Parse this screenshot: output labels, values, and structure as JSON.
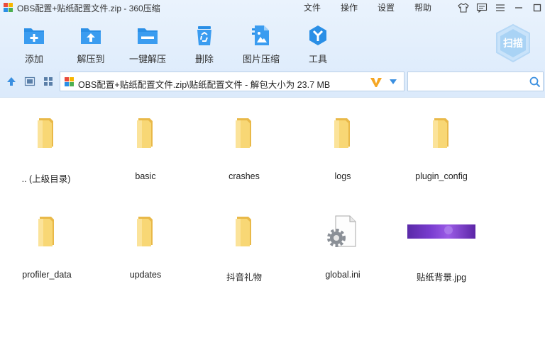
{
  "window": {
    "title": "OBS配置+贴纸配置文件.zip - 360压缩"
  },
  "menu": [
    "文件",
    "操作",
    "设置",
    "帮助"
  ],
  "toolbar": [
    {
      "name": "add",
      "label": "添加"
    },
    {
      "name": "extract-to",
      "label": "解压到"
    },
    {
      "name": "one-click-extract",
      "label": "一键解压"
    },
    {
      "name": "delete",
      "label": "删除"
    },
    {
      "name": "image-compress",
      "label": "图片压缩"
    },
    {
      "name": "tools",
      "label": "工具"
    }
  ],
  "scan": {
    "label": "扫描"
  },
  "address": {
    "path": "OBS配置+贴纸配置文件.zip\\贴纸配置文件 - 解包大小为 23.7 MB"
  },
  "search": {
    "value": "",
    "placeholder": ""
  },
  "files": [
    {
      "name": ".. (上级目录)",
      "type": "folder"
    },
    {
      "name": "basic",
      "type": "folder"
    },
    {
      "name": "crashes",
      "type": "folder"
    },
    {
      "name": "logs",
      "type": "folder"
    },
    {
      "name": "plugin_config",
      "type": "folder"
    },
    {
      "name": "profiler_data",
      "type": "folder"
    },
    {
      "name": "updates",
      "type": "folder"
    },
    {
      "name": "抖音礼物",
      "type": "folder"
    },
    {
      "name": "global.ini",
      "type": "ini"
    },
    {
      "name": "贴纸背景.jpg",
      "type": "image"
    }
  ],
  "colors": {
    "accent": "#2a8fe6",
    "folder": "#f8d775",
    "folder_dark": "#e9b949",
    "scan": "#a9d3f5"
  }
}
